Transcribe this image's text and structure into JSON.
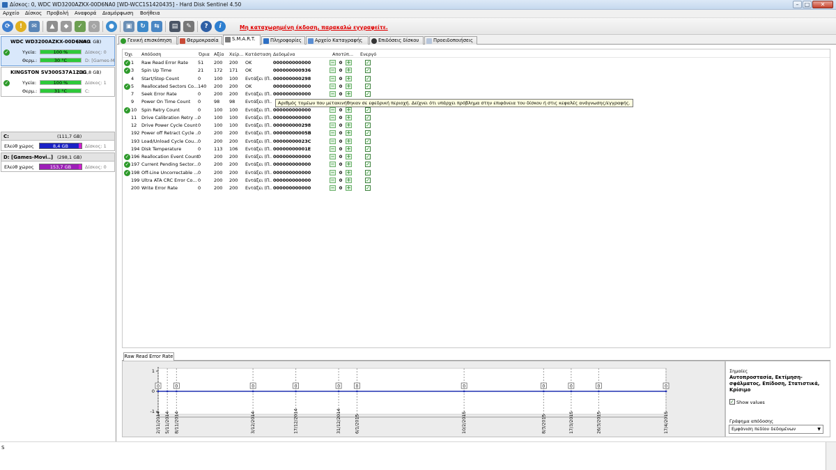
{
  "window": {
    "title": "Δίσκος: 0, WDC WD3200AZKX-00D6NA0 [WD-WCC1S1420435]  -  Hard Disk Sentinel 4.50",
    "min": "–",
    "max": "□",
    "close": "✕"
  },
  "menu": [
    "Αρχείο",
    "Δίσκος",
    "Προβολή",
    "Αναφορά",
    "Διαμόρφωση",
    "Βοήθεια"
  ],
  "toolbar": {
    "registration_message": "Μη καταχωρημένη έκδοση, παρακαλώ εγγραφείτε.",
    "help_glyph": "?",
    "info_glyph": "i"
  },
  "disks": [
    {
      "name": "WDC WD3200AZKX-00D6NA0",
      "size": "(298,1 GB)",
      "health_label": "Υγεία:",
      "health_value": "100 %",
      "health_percent": 100,
      "temp_label": "Θερμ.:",
      "temp_value": "30 °C",
      "disk_note": "Δίσκος: 0",
      "drive_note": "D: [Games-M"
    },
    {
      "name": "KINGSTON SV300S37A120G",
      "size": "(111,8 GB)",
      "health_label": "Υγεία:",
      "health_value": "100 %",
      "health_percent": 100,
      "temp_label": "Θερμ.:",
      "temp_value": "31 °C",
      "disk_note": "Δίσκος: 1",
      "drive_note": "C:"
    }
  ],
  "partitions": [
    {
      "name": "C:",
      "size": "(111,7 GB)",
      "free_label": "Ελεύθ χώρος",
      "free_value": "8,4 GB",
      "disk_note": "Δίσκος: 1"
    },
    {
      "name": "D: [Games-Movi..]",
      "size": "(298,1 GB)",
      "free_label": "Ελεύθ χώρος",
      "free_value": "153,7 GB",
      "disk_note": "Δίσκος: 0"
    }
  ],
  "tabs": [
    "Γενική επισκόπηση",
    "Θερμοκρασία",
    "S.M.A.R.T.",
    "Πληροφορίες",
    "Αρχείο Καταγραφής",
    "Επιδόσεις δίσκου",
    "Προειδοποιήσεις"
  ],
  "smart": {
    "headers": {
      "id": "Όχι",
      "attr": "Απόδοση",
      "threshold": "Όρια",
      "value": "Αξία",
      "worst": "Χείρ...",
      "status": "Κατάσταση",
      "data": "Δεδομένα",
      "offset": "Αποτύπ...",
      "active": "Ενεργό"
    },
    "rows": [
      {
        "id": "1",
        "name": "Raw Read Error Rate",
        "thr": "51",
        "val": "200",
        "worst": "200",
        "status": "OK",
        "data": "000000000000",
        "ok": true
      },
      {
        "id": "3",
        "name": "Spin Up Time",
        "thr": "21",
        "val": "172",
        "worst": "171",
        "status": "OK",
        "data": "000000000936",
        "ok": true
      },
      {
        "id": "4",
        "name": "Start/Stop Count",
        "thr": "0",
        "val": "100",
        "worst": "100",
        "status": "Εντάξει (Π...",
        "data": "000000000298",
        "ok": false
      },
      {
        "id": "5",
        "name": "Reallocated Sectors Co...",
        "thr": "140",
        "val": "200",
        "worst": "200",
        "status": "OK",
        "data": "000000000000",
        "ok": true
      },
      {
        "id": "7",
        "name": "Seek Error Rate",
        "thr": "0",
        "val": "200",
        "worst": "200",
        "status": "Εντάξει (Π...",
        "data": "000000000000",
        "ok": false
      },
      {
        "id": "9",
        "name": "Power On Time Count",
        "thr": "0",
        "val": "98",
        "worst": "98",
        "status": "Εντάξει (Π...",
        "data": "",
        "ok": false
      },
      {
        "id": "10",
        "name": "Spin Retry Count",
        "thr": "0",
        "val": "100",
        "worst": "100",
        "status": "Εντάξει (Π...",
        "data": "000000000000",
        "ok": true
      },
      {
        "id": "11",
        "name": "Drive Calibration Retry ...",
        "thr": "0",
        "val": "100",
        "worst": "100",
        "status": "Εντάξει (Π...",
        "data": "000000000000",
        "ok": false
      },
      {
        "id": "12",
        "name": "Drive Power Cycle Count",
        "thr": "0",
        "val": "100",
        "worst": "100",
        "status": "Εντάξει (Π...",
        "data": "000000000298",
        "ok": false
      },
      {
        "id": "192",
        "name": "Power off Retract Cycle ...",
        "thr": "0",
        "val": "200",
        "worst": "200",
        "status": "Εντάξει (Π...",
        "data": "00000000005B",
        "ok": false
      },
      {
        "id": "193",
        "name": "Load/Unload Cycle Cou...",
        "thr": "0",
        "val": "200",
        "worst": "200",
        "status": "Εντάξει (Π...",
        "data": "00000000023C",
        "ok": false
      },
      {
        "id": "194",
        "name": "Disk Temperature",
        "thr": "0",
        "val": "113",
        "worst": "106",
        "status": "Εντάξει (Π...",
        "data": "00000000001E",
        "ok": false
      },
      {
        "id": "196",
        "name": "Reallocation Event Count",
        "thr": "0",
        "val": "200",
        "worst": "200",
        "status": "Εντάξει (Π...",
        "data": "000000000000",
        "ok": true
      },
      {
        "id": "197",
        "name": "Current Pending Sector...",
        "thr": "0",
        "val": "200",
        "worst": "200",
        "status": "Εντάξει (Π...",
        "data": "000000000000",
        "ok": true
      },
      {
        "id": "198",
        "name": "Off-Line Uncorrectable ...",
        "thr": "0",
        "val": "200",
        "worst": "200",
        "status": "Εντάξει (Π...",
        "data": "000000000000",
        "ok": true
      },
      {
        "id": "199",
        "name": "Ultra ATA CRC Error Co...",
        "thr": "0",
        "val": "200",
        "worst": "200",
        "status": "Εντάξει (Π...",
        "data": "000000000000",
        "ok": false
      },
      {
        "id": "200",
        "name": "Write Error Rate",
        "thr": "0",
        "val": "200",
        "worst": "200",
        "status": "Εντάξει (Π...",
        "data": "000000000000",
        "ok": false
      }
    ],
    "offset_value": "0",
    "tooltip": "Αριθμός τομέων που μετακινήθηκαν σε εφεδρική περιοχή. Δείχνει ότι υπάρχει πρόβλημα στην επιφάνεια του δίσκου ή στις κεφαλές ανάγνωσης/εγγραφής."
  },
  "graph": {
    "tab_label": "Raw Read Error Rate",
    "y_ticks": [
      "1",
      "0",
      "-1"
    ],
    "point_label": "0",
    "dates": [
      "2/11/2014",
      "5/11/2014",
      "8/11/2014",
      "3/12/2014",
      "17/12/2014",
      "31/12/2014",
      "6/1/2015",
      "10/2/2015",
      "8/3/2015",
      "17/3/2015",
      "26/3/2015",
      "17/4/2015"
    ],
    "labeled_points": [
      0,
      2,
      3,
      4,
      5,
      6,
      7,
      8,
      9,
      10,
      11
    ]
  },
  "legend": {
    "title": "Σημαίες",
    "flags": "Αυτοπροστασία, Εκτίμηση-σφάλματος, Επίδοση, Στατιστικά, Κρίσιμο",
    "show_values_label": "Show values",
    "show_values_checked": "✓",
    "graph_select_title": "Γράφημα απόδοσης",
    "graph_select_value": "Εμφάνιση πεδίου δεδομένων"
  },
  "status": {
    "fragment": "S"
  }
}
